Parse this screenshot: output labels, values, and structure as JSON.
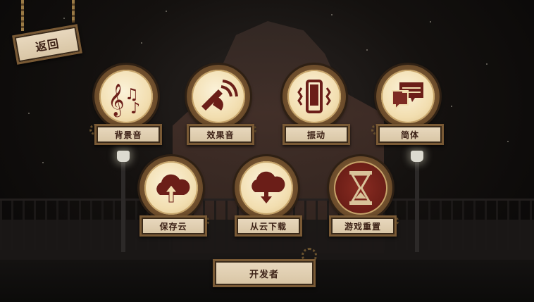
{
  "header": {
    "back_label": "返回"
  },
  "settings": {
    "row1": [
      {
        "label": "背景音",
        "icon": "music-notes-icon"
      },
      {
        "label": "效果音",
        "icon": "speaker-sound-icon"
      },
      {
        "label": "振动",
        "icon": "phone-vibrate-icon"
      },
      {
        "label": "简体",
        "icon": "chat-bubbles-icon"
      }
    ],
    "row2": [
      {
        "label": "保存云",
        "icon": "cloud-upload-icon"
      },
      {
        "label": "从云下载",
        "icon": "cloud-download-icon"
      },
      {
        "label": "游戏重置",
        "icon": "hourglass-icon"
      }
    ]
  },
  "footer": {
    "developer_label": "开发者"
  },
  "colors": {
    "icon_maroon": "#6b1e18",
    "plaque": "#e2d2b4",
    "bronze": "#7a5a35"
  }
}
